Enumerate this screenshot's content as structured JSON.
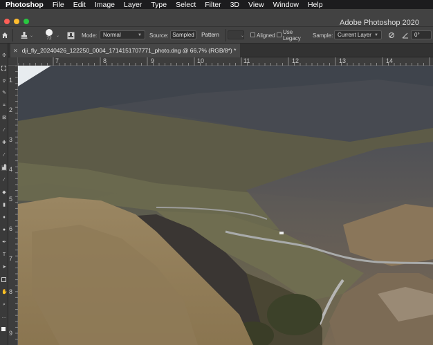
{
  "menubar": {
    "app_name": "Photoshop",
    "items": [
      "File",
      "Edit",
      "Image",
      "Layer",
      "Type",
      "Select",
      "Filter",
      "3D",
      "View",
      "Window",
      "Help"
    ]
  },
  "app_title": "Adobe Photoshop 2020",
  "options": {
    "brush_size": "72",
    "mode_label": "Mode:",
    "mode_value": "Normal",
    "source_label": "Source:",
    "source_sampled": "Sampled",
    "source_pattern": "Pattern",
    "aligned_label": "Aligned",
    "use_legacy_label": "Use Legacy",
    "sample_label": "Sample:",
    "sample_value": "Current Layer",
    "angle_value": "0°"
  },
  "document": {
    "tab_title": "dji_fly_20240426_122250_0004_1714151707771_photo.dng @ 66.7% (RGB/8*) *"
  },
  "ruler": {
    "h_labels": [
      "7",
      "8",
      "9",
      "10",
      "11",
      "12",
      "13",
      "14"
    ],
    "v_labels": [
      "1",
      "2",
      "3",
      "4",
      "5",
      "6",
      "7",
      "8",
      "9"
    ]
  },
  "colors": {
    "accent": "#2d6fd6",
    "close": "#fe5f57",
    "minimize": "#febc2e",
    "zoom": "#28c840"
  }
}
